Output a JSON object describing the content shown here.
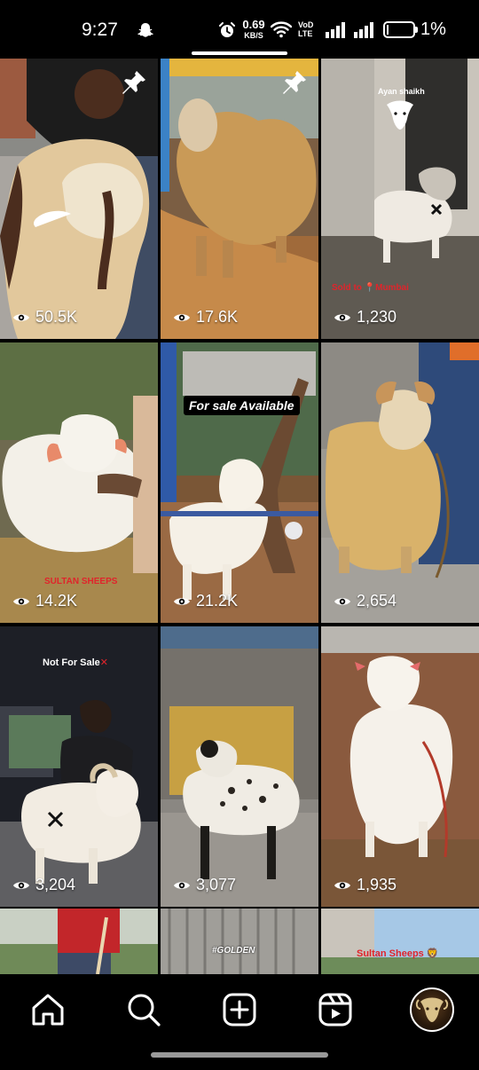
{
  "status_bar": {
    "time": "9:27",
    "network_speed_value": "0.69",
    "network_speed_unit": "KB/S",
    "volte_line1": "Vo",
    "volte_line2": "LTE",
    "volte_line2_prefix": "D",
    "battery_percent": "1%",
    "icons": [
      "snapchat-icon",
      "alarm-icon",
      "wifi-icon",
      "signal-icon",
      "battery-icon"
    ]
  },
  "grid": {
    "tiles": [
      {
        "views": "50.5K",
        "pinned": true
      },
      {
        "views": "17.6K",
        "pinned": true
      },
      {
        "views": "1,230",
        "overlay_top": "Ayan shaikh",
        "overlay_bottom": "Sold to 📍Mumbai"
      },
      {
        "views": "14.2K",
        "overlay_bottom": "SULTAN SHEEPS"
      },
      {
        "views": "21.2K",
        "overlay_top": "For sale Available"
      },
      {
        "views": "2,654"
      },
      {
        "views": "3,204",
        "overlay_top": "Not For Sale"
      },
      {
        "views": "3,077"
      },
      {
        "views": "1,935"
      },
      {
        "overlay": ""
      },
      {
        "overlay": "#GOLDEN"
      },
      {
        "overlay": "Sultan Sheeps 🦁"
      }
    ]
  },
  "bottom_nav": {
    "items": [
      "home-icon",
      "search-icon",
      "create-icon",
      "reels-icon",
      "profile-avatar"
    ]
  },
  "colors": {
    "background": "#000000",
    "text": "#ffffff",
    "accent_red": "#e0242b"
  }
}
